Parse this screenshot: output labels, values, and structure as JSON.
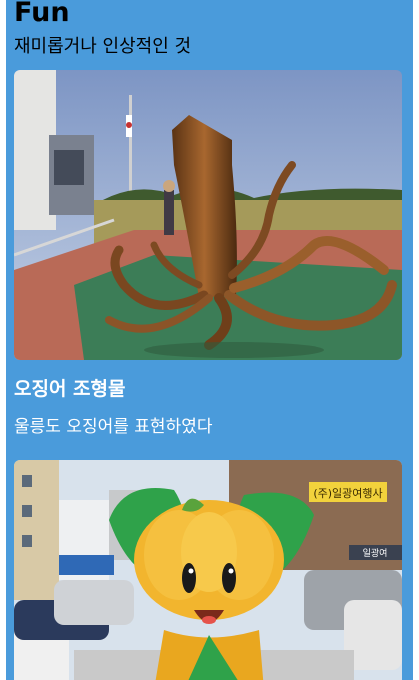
{
  "section": {
    "title": "Fun",
    "subtitle": "재미롭거나 인상적인 것"
  },
  "cards": [
    {
      "title": "오징어 조형물",
      "caption": "울릉도 오징어를 표현하였다",
      "image_subject": "squid-sculpture"
    },
    {
      "image_subject": "mascot-statue",
      "signs": [
        "(주)일광여행사",
        "일광여"
      ]
    }
  ],
  "colors": {
    "background": "#4a9bdb",
    "card_text": "#ffffff",
    "header_text": "#000000"
  }
}
